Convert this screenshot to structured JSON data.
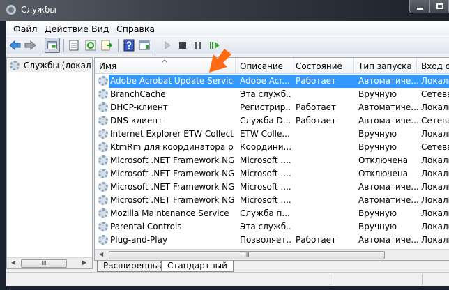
{
  "window": {
    "title": "Службы"
  },
  "menu": [
    {
      "label": "Файл",
      "accel": "Ф",
      "rest": "айл"
    },
    {
      "label": "Действие",
      "accel": "Д",
      "rest": "ействие"
    },
    {
      "label": "Вид",
      "accel": "В",
      "rest": "ид"
    },
    {
      "label": "Справка",
      "accel": "С",
      "rest": "правка"
    }
  ],
  "tree": {
    "item": "Службы (локалы"
  },
  "columns": [
    "Имя",
    "Описание",
    "Состояние",
    "Тип запуска",
    "Вход от"
  ],
  "rows": [
    [
      "Adobe Acrobat Update Service",
      "Adobe Acr...",
      "Работает",
      "Автоматиче...",
      "Локаль"
    ],
    [
      "BranchCache",
      "Эта служб...",
      "",
      "Вручную",
      "Сетевая"
    ],
    [
      "DHCP-клиент",
      "Регистрир...",
      "Работает",
      "Автоматиче...",
      "Локаль"
    ],
    [
      "DNS-клиент",
      "Служба D...",
      "Работает",
      "Автоматиче...",
      "Сетевая"
    ],
    [
      "Internet Explorer ETW Collector ...",
      "ETW Colle...",
      "",
      "Вручную",
      "Локаль"
    ],
    [
      "KtmRm для координатора рас...",
      "Координи...",
      "",
      "Вручную",
      "Сетевая"
    ],
    [
      "Microsoft .NET Framework NGE...",
      "Microsoft ....",
      "",
      "Отключена",
      "Локаль"
    ],
    [
      "Microsoft .NET Framework NGE...",
      "Microsoft ....",
      "",
      "Отключена",
      "Локаль"
    ],
    [
      "Microsoft .NET Framework NGE...",
      "Microsoft ....",
      "",
      "Автоматиче...",
      "Локаль"
    ],
    [
      "Microsoft .NET Framework NGE...",
      "Microsoft ....",
      "",
      "Автоматиче...",
      "Локаль"
    ],
    [
      "Mozilla Maintenance Service",
      "Служба п...",
      "",
      "Вручную",
      "Локаль"
    ],
    [
      "Parental Controls",
      "Эта служб...",
      "",
      "Вручную",
      "Локаль"
    ],
    [
      "Plug-and-Play",
      "Позволяет...",
      "Работает",
      "Автоматиче...",
      "Локаль"
    ]
  ],
  "selected_row": 0,
  "tabs": [
    "Расширенный",
    "Стандартный"
  ],
  "scroll_thumb": "III",
  "colors": {
    "selection": "#3399ff",
    "cursor": "#ff6a13"
  }
}
